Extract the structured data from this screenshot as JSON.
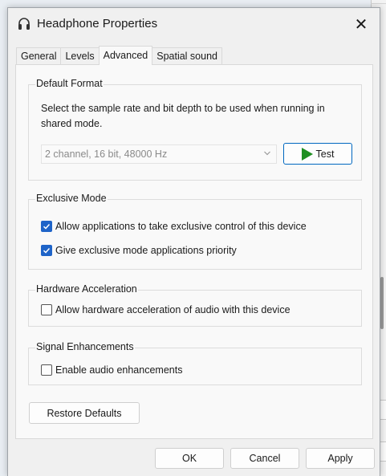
{
  "window": {
    "title": "Headphone Properties",
    "close_glyph": "✕"
  },
  "tabs": [
    {
      "label": "General"
    },
    {
      "label": "Levels"
    },
    {
      "label": "Advanced",
      "active": true
    },
    {
      "label": "Spatial sound"
    }
  ],
  "default_format": {
    "title": "Default Format",
    "description": "Select the sample rate and bit depth to be used when running in shared mode.",
    "selected_format": "2 channel, 16 bit, 48000 Hz",
    "test_label": "Test"
  },
  "exclusive_mode": {
    "title": "Exclusive Mode",
    "options": [
      {
        "label": "Allow applications to take exclusive control of this device",
        "checked": true
      },
      {
        "label": "Give exclusive mode applications priority",
        "checked": true
      }
    ]
  },
  "hardware_acceleration": {
    "title": "Hardware Acceleration",
    "option": {
      "label": "Allow hardware acceleration of audio with this device",
      "checked": false
    }
  },
  "signal_enhancements": {
    "title": "Signal Enhancements",
    "option": {
      "label": "Enable audio enhancements",
      "checked": false
    }
  },
  "buttons": {
    "restore_defaults": "Restore Defaults",
    "ok": "OK",
    "cancel": "Cancel",
    "apply": "Apply"
  },
  "icons": {
    "title": "headphone-icon",
    "test": "play-icon",
    "dropdown": "chevron-down-icon",
    "check": "checkmark-icon"
  },
  "colors": {
    "accent": "#0067c0",
    "checkbox_on": "#1f64c8",
    "play": "#1f8f22"
  }
}
